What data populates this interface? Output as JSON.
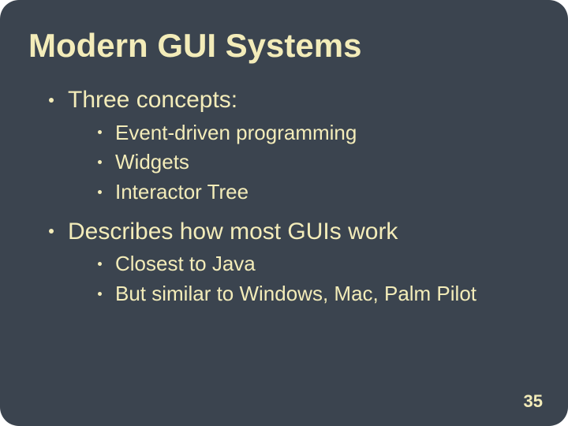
{
  "title": "Modern GUI Systems",
  "points": [
    {
      "text": "Three concepts:",
      "sub": [
        "Event-driven programming",
        "Widgets",
        "Interactor Tree"
      ]
    },
    {
      "text": "Describes how most GUIs work",
      "sub": [
        "Closest to Java",
        "But similar to Windows, Mac, Palm Pilot"
      ]
    }
  ],
  "page_number": "35"
}
